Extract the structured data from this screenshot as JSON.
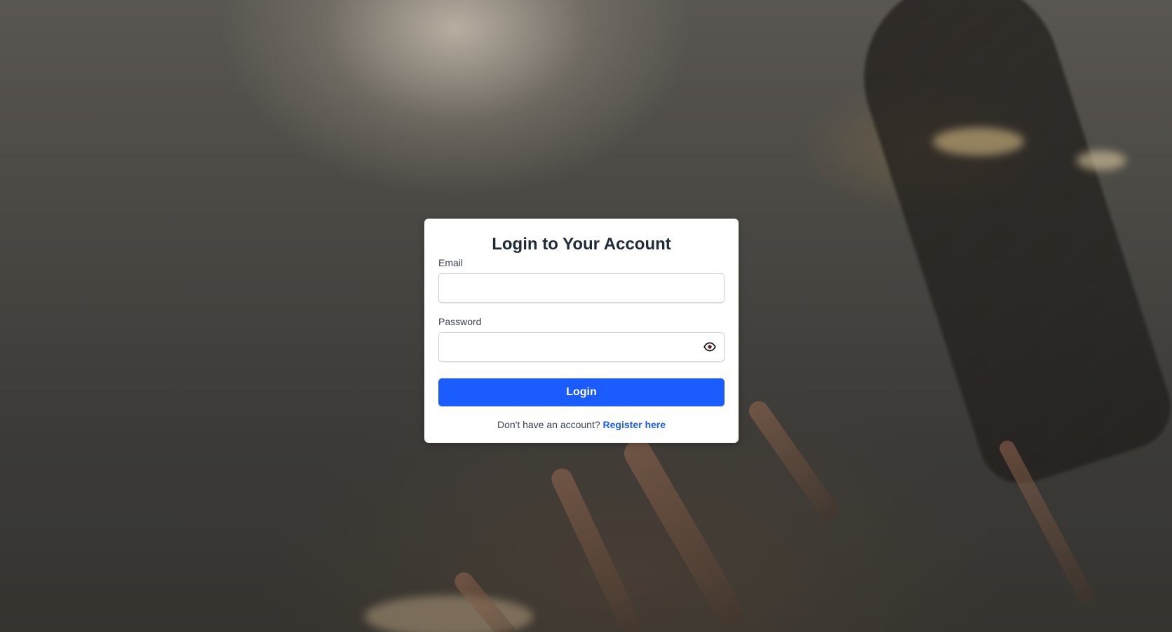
{
  "background": {
    "description_icon": "concert-crowd-image"
  },
  "login_card": {
    "title": "Login to Your Account",
    "email_label": "Email",
    "email_value": "",
    "email_placeholder": "",
    "password_label": "Password",
    "password_value": "",
    "password_placeholder": "",
    "password_toggle_icon": "eye-icon",
    "login_button": "Login",
    "register_prompt": "Don't have an account?",
    "register_link": "Register here"
  },
  "colors": {
    "accent": "#1a5cff",
    "card_bg": "#ffffff",
    "title_text": "#1f2937"
  }
}
